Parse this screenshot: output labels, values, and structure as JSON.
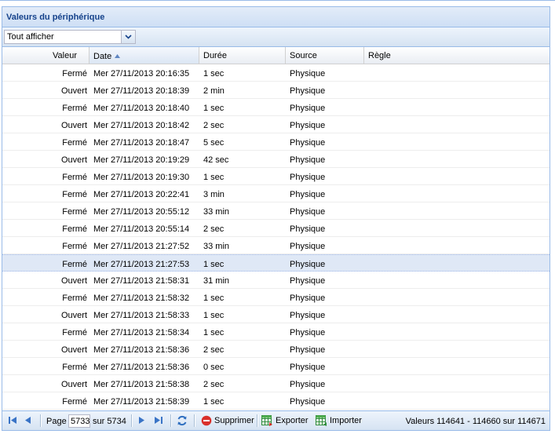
{
  "panel": {
    "title": "Valeurs du périphérique"
  },
  "filter": {
    "selected": "Tout afficher",
    "trigger_icon": "chevron-down-icon"
  },
  "columns": [
    {
      "key": "valeur",
      "label": "Valeur"
    },
    {
      "key": "date",
      "label": "Date",
      "sorted": "asc"
    },
    {
      "key": "duree",
      "label": "Durée"
    },
    {
      "key": "source",
      "label": "Source"
    },
    {
      "key": "regle",
      "label": "Règle"
    }
  ],
  "rows": [
    {
      "valeur": "Fermé",
      "date": "Mer 27/11/2013 20:16:35",
      "duree": "1 sec",
      "source": "Physique"
    },
    {
      "valeur": "Ouvert",
      "date": "Mer 27/11/2013 20:18:39",
      "duree": "2 min",
      "source": "Physique"
    },
    {
      "valeur": "Fermé",
      "date": "Mer 27/11/2013 20:18:40",
      "duree": "1 sec",
      "source": "Physique"
    },
    {
      "valeur": "Ouvert",
      "date": "Mer 27/11/2013 20:18:42",
      "duree": "2 sec",
      "source": "Physique"
    },
    {
      "valeur": "Fermé",
      "date": "Mer 27/11/2013 20:18:47",
      "duree": "5 sec",
      "source": "Physique"
    },
    {
      "valeur": "Ouvert",
      "date": "Mer 27/11/2013 20:19:29",
      "duree": "42 sec",
      "source": "Physique"
    },
    {
      "valeur": "Fermé",
      "date": "Mer 27/11/2013 20:19:30",
      "duree": "1 sec",
      "source": "Physique"
    },
    {
      "valeur": "Fermé",
      "date": "Mer 27/11/2013 20:22:41",
      "duree": "3 min",
      "source": "Physique"
    },
    {
      "valeur": "Fermé",
      "date": "Mer 27/11/2013 20:55:12",
      "duree": "33 min",
      "source": "Physique"
    },
    {
      "valeur": "Fermé",
      "date": "Mer 27/11/2013 20:55:14",
      "duree": "2 sec",
      "source": "Physique"
    },
    {
      "valeur": "Fermé",
      "date": "Mer 27/11/2013 21:27:52",
      "duree": "33 min",
      "source": "Physique"
    },
    {
      "valeur": "Fermé",
      "date": "Mer 27/11/2013 21:27:53",
      "duree": "1 sec",
      "source": "Physique",
      "selected": true
    },
    {
      "valeur": "Ouvert",
      "date": "Mer 27/11/2013 21:58:31",
      "duree": "31 min",
      "source": "Physique"
    },
    {
      "valeur": "Fermé",
      "date": "Mer 27/11/2013 21:58:32",
      "duree": "1 sec",
      "source": "Physique"
    },
    {
      "valeur": "Ouvert",
      "date": "Mer 27/11/2013 21:58:33",
      "duree": "1 sec",
      "source": "Physique"
    },
    {
      "valeur": "Fermé",
      "date": "Mer 27/11/2013 21:58:34",
      "duree": "1 sec",
      "source": "Physique"
    },
    {
      "valeur": "Ouvert",
      "date": "Mer 27/11/2013 21:58:36",
      "duree": "2 sec",
      "source": "Physique"
    },
    {
      "valeur": "Fermé",
      "date": "Mer 27/11/2013 21:58:36",
      "duree": "0 sec",
      "source": "Physique"
    },
    {
      "valeur": "Ouvert",
      "date": "Mer 27/11/2013 21:58:38",
      "duree": "2 sec",
      "source": "Physique"
    },
    {
      "valeur": "Fermé",
      "date": "Mer 27/11/2013 21:58:39",
      "duree": "1 sec",
      "source": "Physique"
    }
  ],
  "pager": {
    "page_label": "Page",
    "current_page": "5733",
    "of_label": "sur 5734",
    "delete_label": "Supprimer",
    "export_label": "Exporter",
    "import_label": "Importer",
    "info": "Valeurs 114641 - 114660 sur 114671"
  }
}
